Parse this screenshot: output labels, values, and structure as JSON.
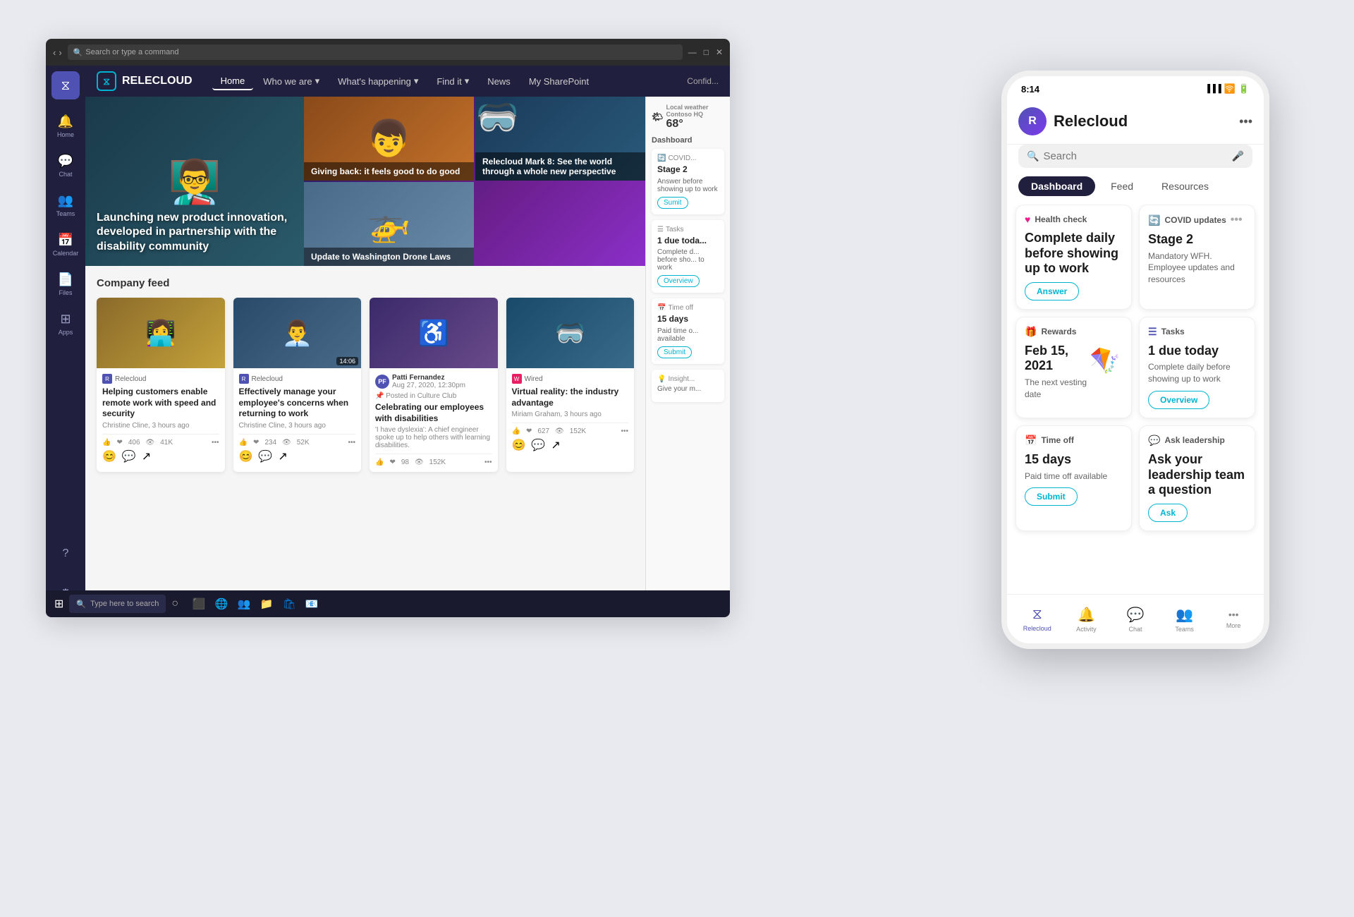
{
  "desktop": {
    "titlebar": {
      "search_placeholder": "Search or type a command"
    },
    "logo": {
      "text": "RELECLOUD",
      "icon": "⧖"
    },
    "nav": {
      "items": [
        {
          "label": "Home",
          "active": true
        },
        {
          "label": "Who we are",
          "dropdown": true
        },
        {
          "label": "What's happening",
          "dropdown": true
        },
        {
          "label": "Find it",
          "dropdown": true
        },
        {
          "label": "News"
        },
        {
          "label": "My SharePoint"
        }
      ]
    },
    "hero": {
      "main_headline": "Launching new product innovation, developed in partnership with the disability community",
      "grid_items": [
        {
          "label": "Giving back: it feels good to do good"
        },
        {
          "label": "Relecloud Mark 8: See the world through a whole new perspective"
        },
        {
          "label": "Update to Washington Drone Laws"
        }
      ]
    },
    "feed": {
      "title": "Company feed",
      "cards": [
        {
          "source": "Relecloud",
          "title": "Helping customers enable remote work with speed and security",
          "author": "Christine Cline",
          "date": "3 hours ago",
          "likes": "406",
          "views": "41K"
        },
        {
          "source": "Relecloud",
          "title": "Effectively manage your employee's concerns when returning to work",
          "author": "Christine Cline",
          "date": "3 hours ago",
          "likes": "234",
          "views": "52K",
          "has_video": true,
          "duration": "14:06"
        },
        {
          "source": "Culture Club",
          "user_name": "Patti Fernandez",
          "user_date": "Aug 27, 2020, 12:30pm",
          "title": "Celebrating our employees with disabilities",
          "description": "'I have dyslexia': A chief engineer spoke up to help others with learning disabilities.",
          "likes": "98",
          "views": "152K"
        },
        {
          "source": "Wired",
          "title": "Virtual reality: the industry advantage",
          "author": "Miriam Graham",
          "date": "3 hours ago",
          "likes": "627",
          "views": "152K"
        }
      ]
    },
    "dashboard": {
      "weather": {
        "label": "Local weather",
        "location": "Contoso HQ",
        "temp": "68°",
        "icon": "🌤"
      },
      "cards": [
        {
          "type": "covid",
          "label": "COVID...",
          "title": "Stage 2",
          "subtitle": "Answer before showing up to work",
          "btn": "Sumit"
        },
        {
          "type": "tasks",
          "label": "Tasks",
          "title": "1 due toda...",
          "subtitle": "Complete d... before sho... to work",
          "btn": "Overview"
        },
        {
          "type": "timeoff",
          "label": "Time off",
          "title": "15 days",
          "subtitle": "Paid time o... available",
          "btn": "Submit"
        },
        {
          "type": "insights",
          "label": "Insight...",
          "subtitle": "Give your m..."
        }
      ]
    },
    "taskbar": {
      "search": "Type here to search",
      "apps": [
        "⊞",
        "🔍",
        "🎬",
        "👥",
        "📅",
        "📁",
        "🌐",
        "📧"
      ]
    }
  },
  "mobile": {
    "status": {
      "time": "8:14",
      "signal": "▐▐▐",
      "wifi": "WiFi",
      "battery": "🔋"
    },
    "header": {
      "app_name": "Relecloud",
      "avatar_initials": "R"
    },
    "search": {
      "placeholder": "Search"
    },
    "tabs": [
      {
        "label": "Dashboard",
        "active": true
      },
      {
        "label": "Feed"
      },
      {
        "label": "Resources"
      }
    ],
    "cards": [
      {
        "id": "health-check",
        "icon_type": "health",
        "icon": "♥",
        "label": "Health check",
        "title": "Complete daily before showing up to work",
        "btn_label": "Answer"
      },
      {
        "id": "covid-updates",
        "icon_type": "covid",
        "icon": "🔄",
        "label": "COVID updates",
        "title": "Stage 2",
        "subtitle": "Mandatory WFH. Employee updates and resources",
        "has_more": true
      },
      {
        "id": "rewards",
        "icon_type": "rewards",
        "icon": "🎁",
        "label": "Rewards",
        "title": "Feb 15, 2021",
        "subtitle": "The next vesting date",
        "has_image": true,
        "image": "🪁"
      },
      {
        "id": "tasks",
        "icon_type": "tasks",
        "icon": "☰",
        "label": "Tasks",
        "title": "1 due today",
        "subtitle": "Complete daily before showing up to work",
        "btn_label": "Overview"
      },
      {
        "id": "time-off",
        "icon_type": "timeoff",
        "icon": "📅",
        "label": "Time off",
        "title": "15 days",
        "subtitle": "Paid time off available",
        "btn_label": "Submit"
      },
      {
        "id": "ask-leadership",
        "icon_type": "leadership",
        "icon": "💬",
        "label": "Ask leadership",
        "title": "Ask your leadership team a question",
        "btn_label": "Ask"
      }
    ],
    "bottom_nav": [
      {
        "label": "Relecloud",
        "icon": "⧖",
        "active": true
      },
      {
        "label": "Activity",
        "icon": "🔔"
      },
      {
        "label": "Chat",
        "icon": "💬"
      },
      {
        "label": "Teams",
        "icon": "👥"
      },
      {
        "label": "More",
        "icon": "•••"
      }
    ]
  }
}
